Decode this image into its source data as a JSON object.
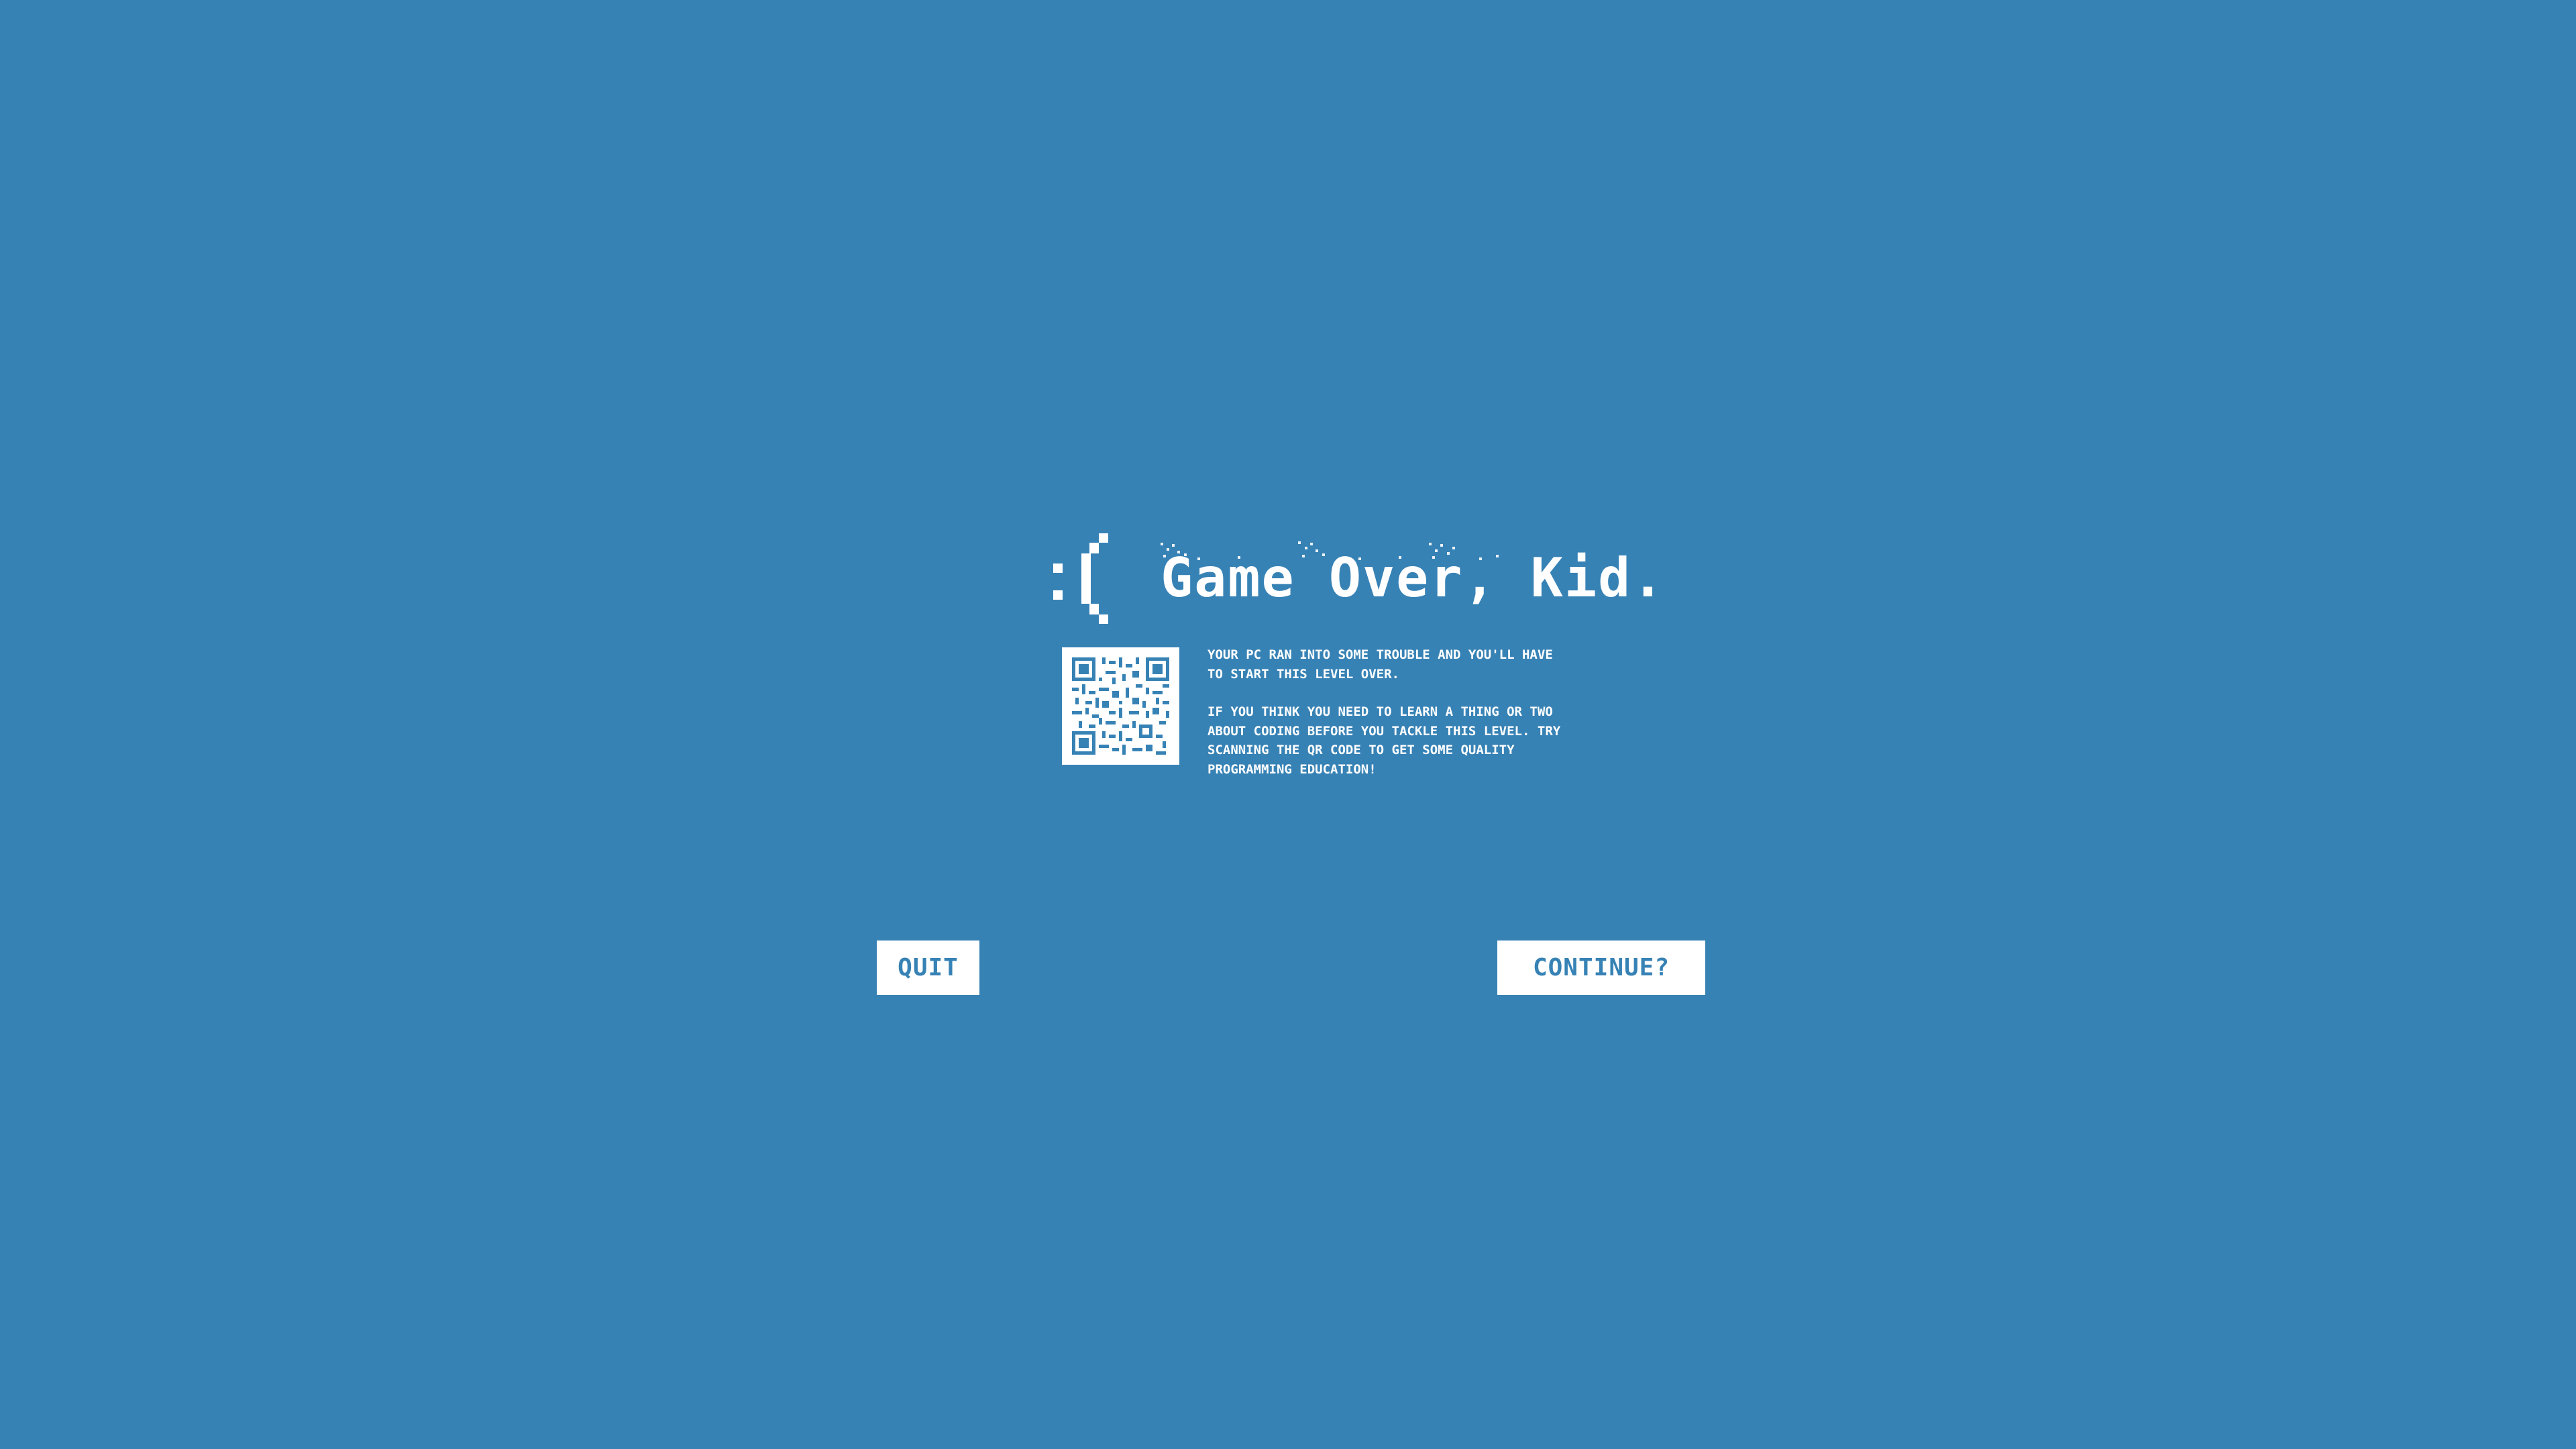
{
  "background_color": "#3782b5",
  "accent_color": "#ffffff",
  "icons": {
    "frown": "frown-face-icon",
    "qr": "qr-code-icon"
  },
  "game_over": {
    "title": "Game Over, Kid.",
    "message_lines": [
      "YOUR PC RAN INTO SOME TROUBLE AND YOU'LL HAVE TO START THIS LEVEL OVER.",
      "IF YOU THINK YOU NEED TO LEARN A THING OR TWO ABOUT CODING BEFORE YOU TACKLE THIS LEVEL. TRY SCANNING THE QR CODE TO GET SOME QUALITY PROGRAMMING EDUCATION!"
    ]
  },
  "buttons": {
    "quit_label": "QUIT",
    "continue_label": "CONTINUE?"
  }
}
